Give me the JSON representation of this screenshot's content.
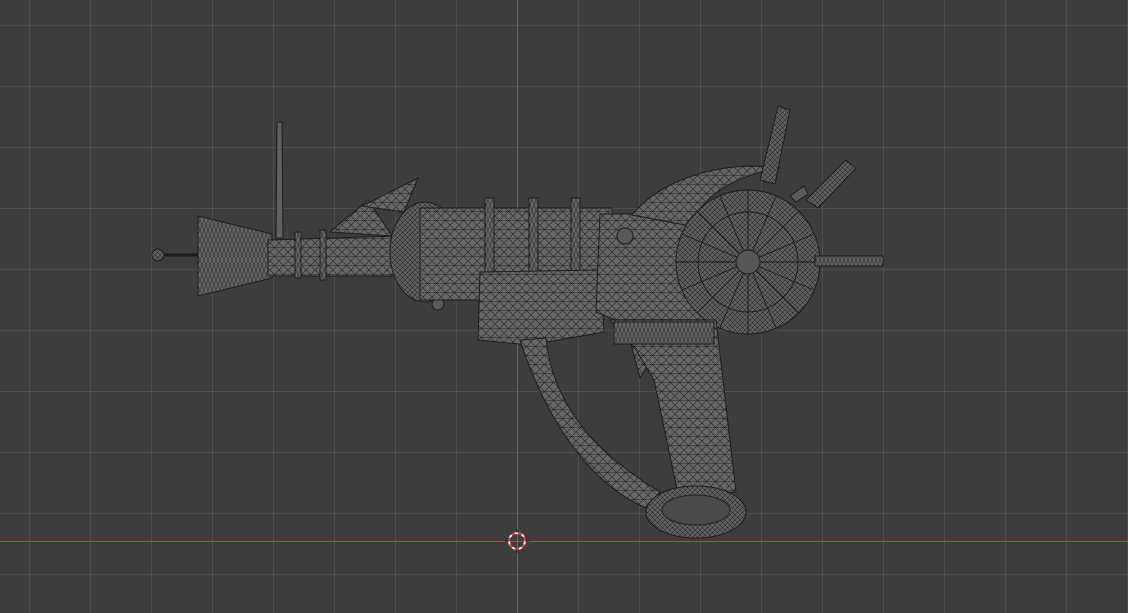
{
  "viewport": {
    "mode": "wireframe",
    "view": "side",
    "colors": {
      "background": "#3d3d3d",
      "grid": "#4a4a4a",
      "x_axis": "#a0553e",
      "z_axis": "#3b78a8",
      "wire": "#202020",
      "mesh_fill": "#6a6a6a",
      "cursor_red": "#e04040",
      "cursor_white": "#f0f0f0"
    },
    "objects": [
      {
        "name": "ray-gun-mesh",
        "icon": "wireframe-mesh"
      },
      {
        "name": "3d-cursor",
        "icon": "crosshair-icon"
      }
    ]
  }
}
